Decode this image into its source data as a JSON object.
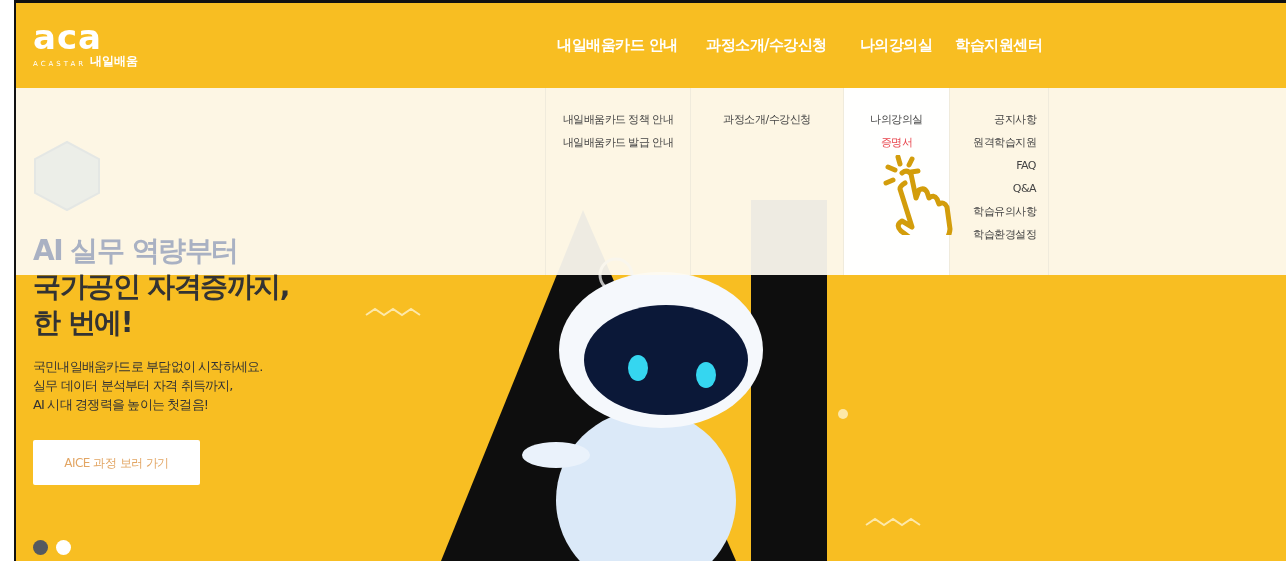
{
  "logo": {
    "mark": "aca",
    "sub": "ACASTAR",
    "name": "내일배움"
  },
  "nav": [
    {
      "label": "내일배움카드 안내",
      "selected": false,
      "submenu": [
        {
          "label": "내일배움카드 정책 안내",
          "selected": false
        },
        {
          "label": "내일배움카드 발급 안내",
          "selected": false
        }
      ]
    },
    {
      "label": "과정소개/수강신청",
      "selected": false,
      "submenu": [
        {
          "label": "과정소개/수강신청",
          "selected": false
        }
      ]
    },
    {
      "label": "나의강의실",
      "selected": true,
      "submenu": [
        {
          "label": "나의강의실",
          "selected": false
        },
        {
          "label": "증명서",
          "selected": true
        }
      ]
    },
    {
      "label": "학습지원센터",
      "selected": false,
      "submenu": [
        {
          "label": "공지사항",
          "selected": false
        },
        {
          "label": "원격학습지원",
          "selected": false
        },
        {
          "label": "FAQ",
          "selected": false
        },
        {
          "label": "Q&A",
          "selected": false
        },
        {
          "label": "학습유의사항",
          "selected": false
        },
        {
          "label": "학습환경설정",
          "selected": false
        }
      ]
    }
  ],
  "hero": {
    "headline": [
      "AI 실무 역량부터",
      "국가공인 자격증까지,",
      "한 번에!"
    ],
    "description": [
      "국민내일배움카드로 부담없이 시작하세요.",
      "실무 데이터 분석부터 자격 취득까지,",
      "AI 시대 경쟁력을 높이는 첫걸음!"
    ],
    "button": "AICE 과정 보러 가기"
  },
  "slides": [
    {
      "selected": true
    },
    {
      "selected": false
    }
  ]
}
